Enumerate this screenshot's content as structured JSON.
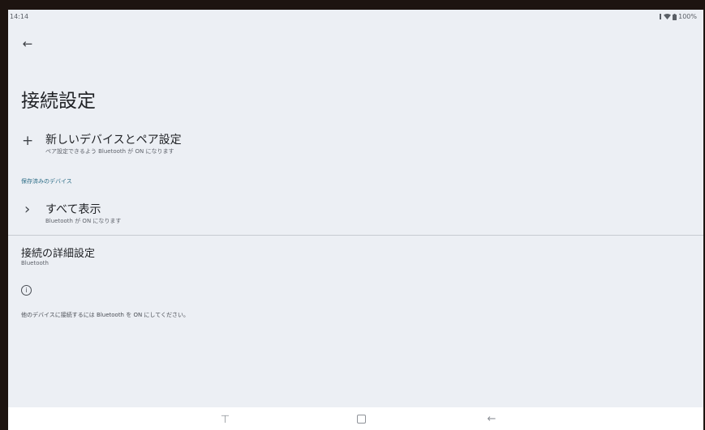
{
  "status_bar": {
    "time": "14:14",
    "battery": "100%"
  },
  "header": {
    "back_icon": "←",
    "title": "接続設定"
  },
  "pair_new": {
    "icon": "+",
    "title": "新しいデバイスとペア設定",
    "subtitle": "ペア設定できるよう Bluetooth が ON になります"
  },
  "saved_section": {
    "label": "保存済みのデバイス"
  },
  "show_all": {
    "icon": "›",
    "title": "すべて表示",
    "subtitle": "Bluetooth が ON になります"
  },
  "advanced": {
    "title": "接続の詳細設定",
    "subtitle": "Bluetooth"
  },
  "info": {
    "icon": "i",
    "text": "他のデバイスに接続するには Bluetooth を ON にしてください。"
  },
  "navbar": {
    "recents_icon": "⊣",
    "back_icon": "←"
  }
}
